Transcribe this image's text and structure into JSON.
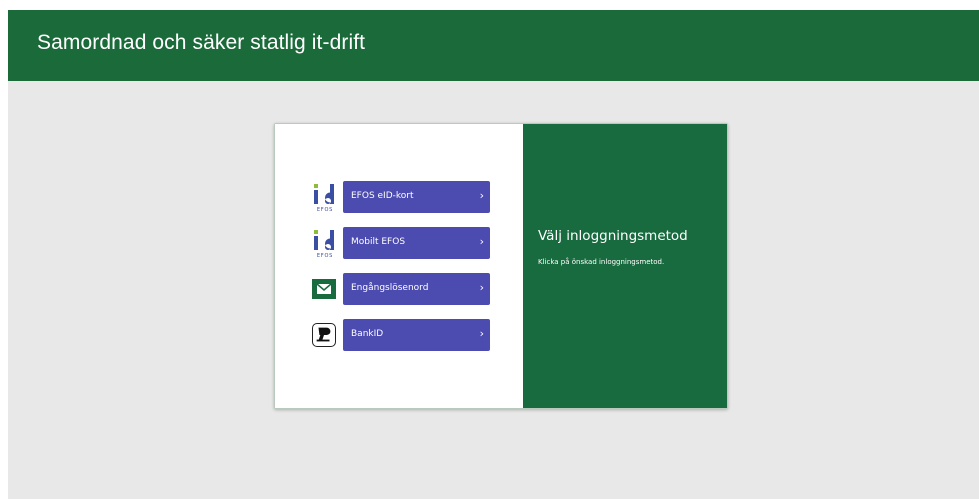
{
  "header": {
    "title": "Samordnad och säker statlig it-drift"
  },
  "login": {
    "methods": [
      {
        "label": "EFOS eID-kort",
        "icon": "efos-id-icon"
      },
      {
        "label": "Mobilt EFOS",
        "icon": "efos-id-icon"
      },
      {
        "label": "Engångslösenord",
        "icon": "mail-icon"
      },
      {
        "label": "BankID",
        "icon": "bankid-icon"
      }
    ],
    "chevron": "›",
    "panel_title": "Välj inloggningsmetod",
    "panel_subtitle": "Klicka på önskad inloggningsmetod."
  },
  "colors": {
    "header_bg": "#1b6b3a",
    "panel_bg": "#176b3e",
    "button_bg": "#4b4bb0",
    "page_bg": "#e8e8e8",
    "efos_blue": "#3a4fa3",
    "efos_green": "#8dbb3a"
  },
  "icon_text": {
    "id": "id",
    "efos": "EFOS"
  }
}
